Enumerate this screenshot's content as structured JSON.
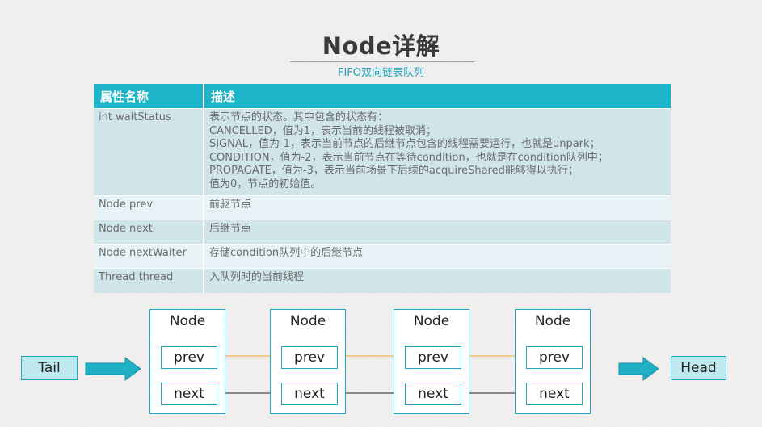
{
  "page": {
    "title": "Node详解",
    "subtitle": "FIFO双向链表队列"
  },
  "table": {
    "headers": [
      "属性名称",
      "描述"
    ],
    "rows": [
      {
        "name": "int waitStatus",
        "desc": [
          "表示节点的状态。其中包含的状态有：",
          "CANCELLED，值为1，表示当前的线程被取消；",
          "SIGNAL，值为-1，表示当前节点的后继节点包含的线程需要运行，也就是unpark；",
          "CONDITION，值为-2，表示当前节点在等待condition，也就是在condition队列中；",
          "PROPAGATE，值为-3，表示当前场景下后续的acquireShared能够得以执行；",
          "值为0，节点的初始值。"
        ]
      },
      {
        "name": "Node prev",
        "desc": [
          "前驱节点"
        ]
      },
      {
        "name": "Node next",
        "desc": [
          "后继节点"
        ]
      },
      {
        "name": "Node nextWaiter",
        "desc": [
          "存储condition队列中的后继节点"
        ]
      },
      {
        "name": "Thread thread",
        "desc": [
          "入队列时的当前线程"
        ]
      }
    ]
  },
  "diagram": {
    "tail_label": "Tail",
    "head_label": "Head",
    "nodes": [
      {
        "title": "Node",
        "prev": "prev",
        "next": "next"
      },
      {
        "title": "Node",
        "prev": "prev",
        "next": "next"
      },
      {
        "title": "Node",
        "prev": "prev",
        "next": "next"
      },
      {
        "title": "Node",
        "prev": "prev",
        "next": "next"
      }
    ],
    "colors": {
      "accent": "#1db3c8",
      "prev_link": "#f0a830",
      "next_link": "#222222",
      "arrow_fill": "#1fb0c4"
    }
  }
}
